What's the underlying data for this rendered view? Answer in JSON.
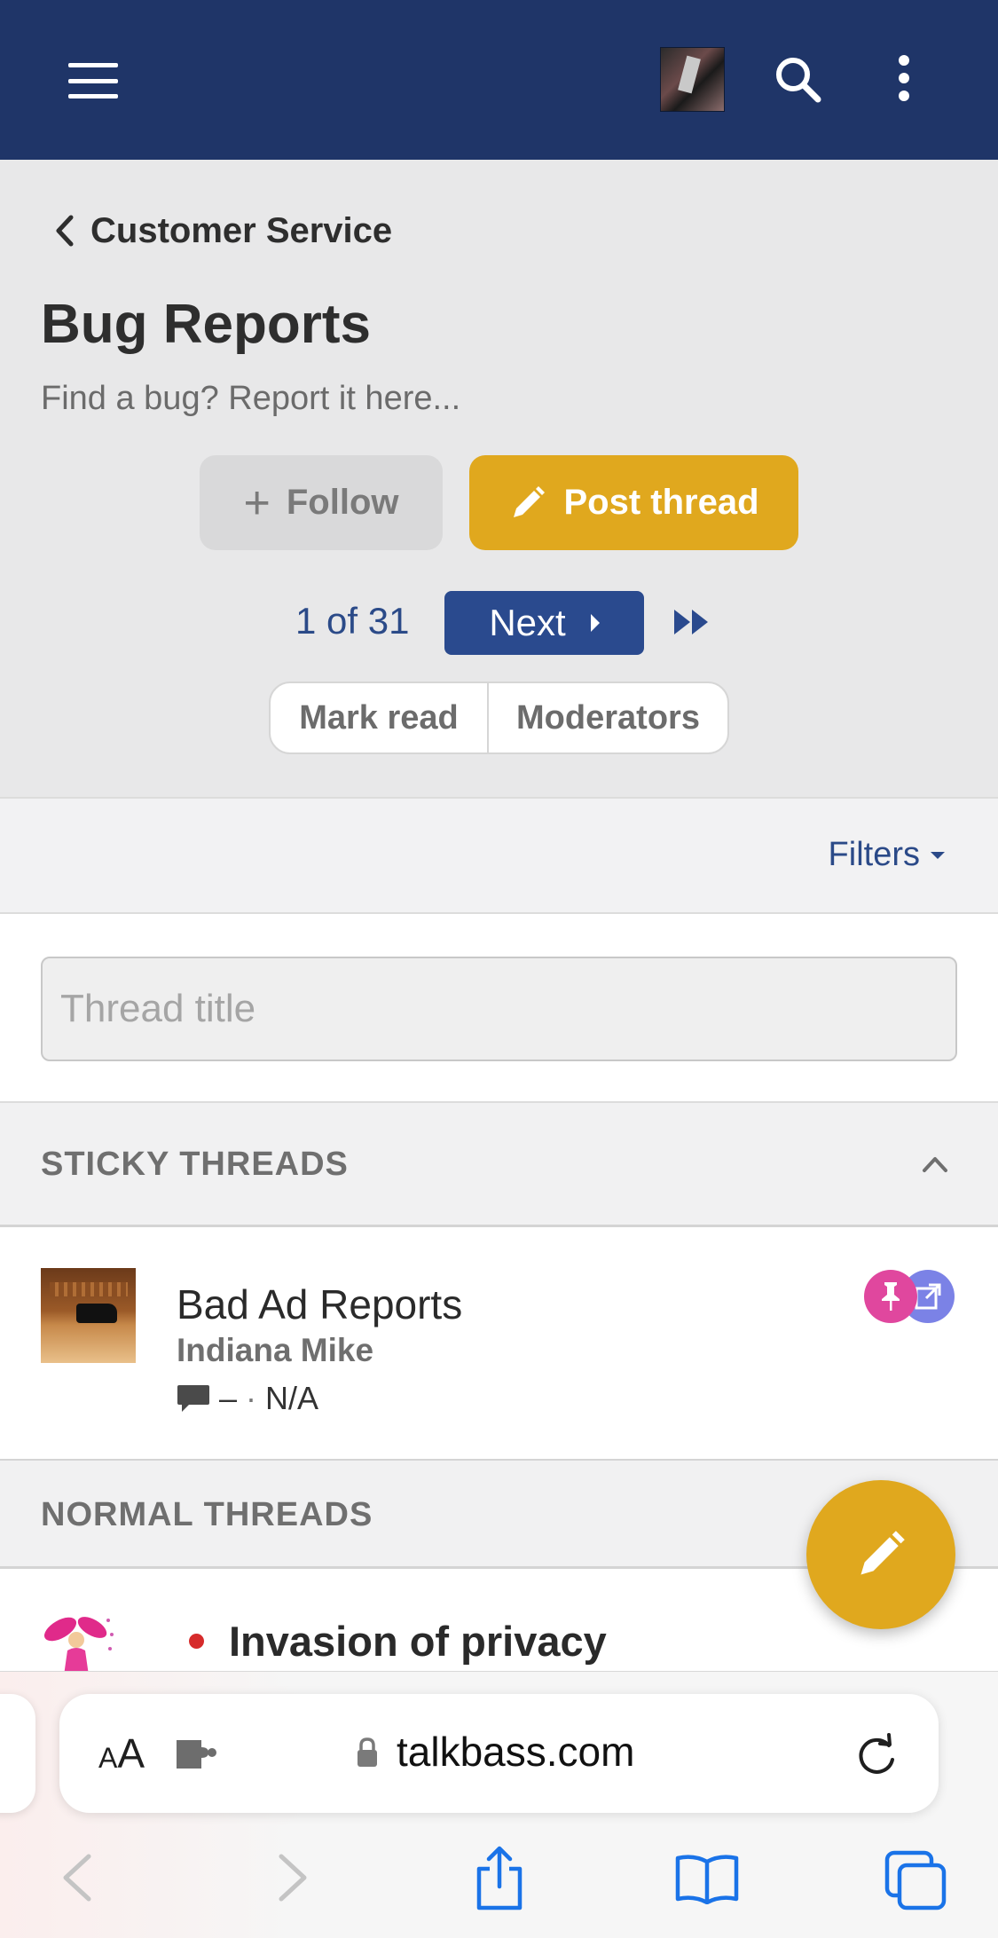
{
  "header": {
    "back_label": "Customer Service",
    "title": "Bug Reports",
    "description": "Find a bug? Report it here..."
  },
  "actions": {
    "follow_label": "Follow",
    "post_label": "Post thread"
  },
  "pagination": {
    "current_text": "1 of 31",
    "next_label": "Next"
  },
  "button_group": {
    "mark_read": "Mark read",
    "moderators": "Moderators"
  },
  "filters": {
    "label": "Filters"
  },
  "search": {
    "placeholder": "Thread title"
  },
  "sticky": {
    "heading": "STICKY THREADS",
    "thread": {
      "title": "Bad Ad Reports",
      "author": "Indiana Mike",
      "replies": "–",
      "last": "N/A"
    }
  },
  "normal": {
    "heading": "NORMAL THREADS",
    "thread": {
      "title": "Invasion of privacy"
    }
  },
  "browser": {
    "aa_small": "A",
    "aa_large": "A",
    "url": "talkbass.com"
  },
  "colors": {
    "navbar": "#1f3568",
    "accent": "#e0a81e",
    "link": "#2b4a88",
    "pin_badge": "#e0479e",
    "redirect_badge": "#7b82e6"
  }
}
